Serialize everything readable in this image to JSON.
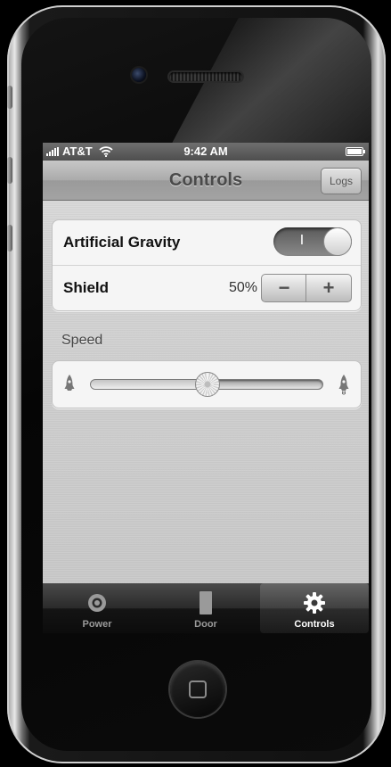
{
  "status_bar": {
    "carrier": "AT&T",
    "time": "9:42 AM"
  },
  "nav": {
    "title": "Controls",
    "button": "Logs"
  },
  "settings": {
    "artificial_gravity": {
      "label": "Artificial Gravity",
      "on": false,
      "toggle_glyph": "I"
    },
    "shield": {
      "label": "Shield",
      "value": "50%",
      "minus": "−",
      "plus": "+"
    }
  },
  "speed": {
    "section_label": "Speed",
    "level_fraction": 0.5
  },
  "tabs": [
    {
      "label": "Power",
      "icon": "power-icon",
      "selected": false
    },
    {
      "label": "Door",
      "icon": "door-icon",
      "selected": false
    },
    {
      "label": "Controls",
      "icon": "gear-icon",
      "selected": true
    }
  ]
}
